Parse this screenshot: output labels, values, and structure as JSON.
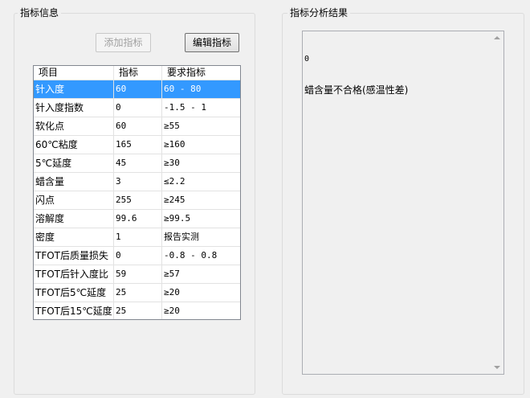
{
  "left_panel": {
    "title": "指标信息",
    "add_button": "添加指标",
    "edit_button": "编辑指标",
    "table": {
      "headers": [
        "项目",
        "指标",
        "要求指标"
      ],
      "rows": [
        [
          "针入度",
          "60",
          "60 - 80"
        ],
        [
          "针入度指数",
          "0",
          "-1.5 - 1"
        ],
        [
          "软化点",
          "60",
          "≥55"
        ],
        [
          "60℃粘度",
          "165",
          "≥160"
        ],
        [
          "5℃延度",
          "45",
          "≥30"
        ],
        [
          "蜡含量",
          "3",
          "≤2.2"
        ],
        [
          "闪点",
          "255",
          "≥245"
        ],
        [
          "溶解度",
          "99.6",
          "≥99.5"
        ],
        [
          "密度",
          "1",
          "报告实测"
        ],
        [
          "TFOT后质量损失",
          "0",
          "-0.8 - 0.8"
        ],
        [
          "TFOT后针入度比",
          "59",
          "≥57"
        ],
        [
          "TFOT后5℃延度",
          "25",
          "≥20"
        ],
        [
          "TFOT后15℃延度",
          "25",
          "≥20"
        ]
      ],
      "selected_row": 0
    }
  },
  "right_panel": {
    "title": "指标分析结果",
    "result_lines": [
      "0",
      "蜡含量不合格(感温性差)"
    ]
  }
}
